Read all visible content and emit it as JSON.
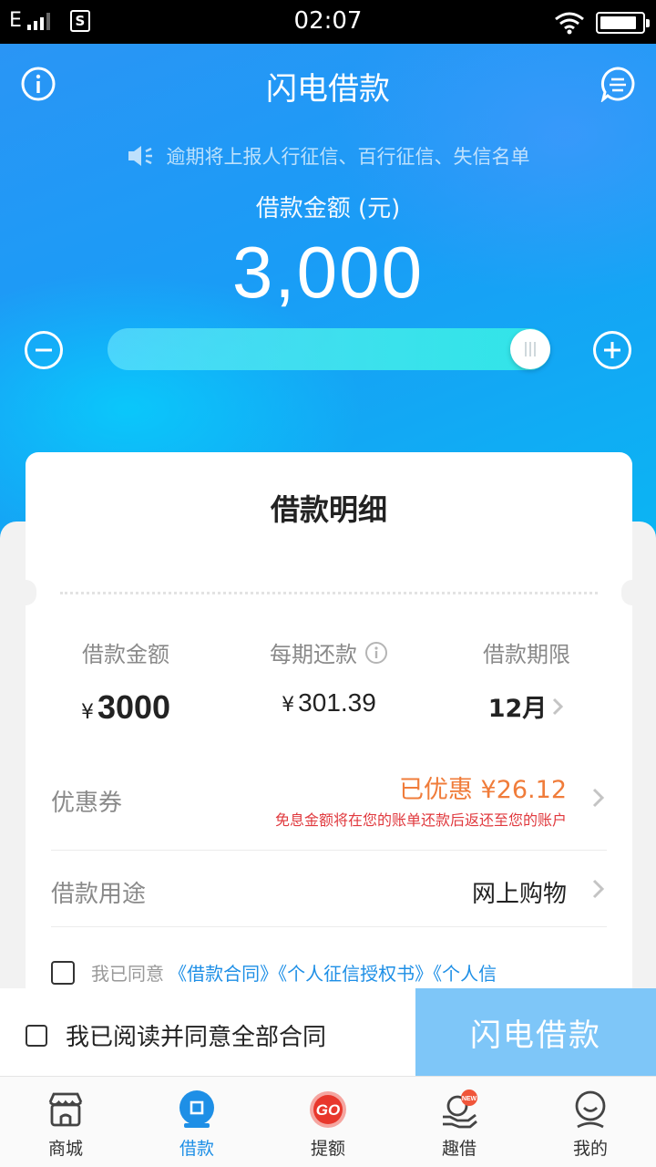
{
  "status_bar": {
    "carrier": "E",
    "time": "02:07",
    "battery_level": 0.88
  },
  "header": {
    "title": "闪电借款"
  },
  "notice": {
    "text": "逾期将上报人行征信、百行征信、失信名单"
  },
  "amount": {
    "label": "借款金额 (元)",
    "value": "3,000",
    "slider_fraction": 1.0
  },
  "detail_card": {
    "title": "借款明细",
    "columns": [
      {
        "label": "借款金额",
        "currency": "¥",
        "value": "3000"
      },
      {
        "label": "每期还款",
        "currency": "¥",
        "value": "301.39"
      },
      {
        "label": "借款期限",
        "value": "12月"
      }
    ],
    "coupon": {
      "label": "优惠券",
      "value": "已优惠 ¥26.12",
      "note": "免息金额将在您的账单还款后返还至您的账户"
    },
    "purpose": {
      "label": "借款用途",
      "value": "网上购物"
    },
    "agreement": {
      "prefix": "我已同意",
      "links": "《借款合同》《个人征信授权书》《个人信"
    }
  },
  "action_bar": {
    "agree_all": "我已阅读并同意全部合同",
    "submit": "闪电借款"
  },
  "tabs": [
    {
      "label": "商城",
      "icon": "store-icon"
    },
    {
      "label": "借款",
      "icon": "loan-icon",
      "active": true
    },
    {
      "label": "提额",
      "icon": "go-badge-icon"
    },
    {
      "label": "趣借",
      "icon": "hand-new-icon",
      "badge": "NEW"
    },
    {
      "label": "我的",
      "icon": "profile-icon"
    }
  ],
  "colors": {
    "primary": "#1a9cf6",
    "accent_orange": "#f07c3a",
    "accent_red": "#e0393e",
    "button_disabled": "#7ec6f8",
    "link": "#1e8fe6"
  }
}
